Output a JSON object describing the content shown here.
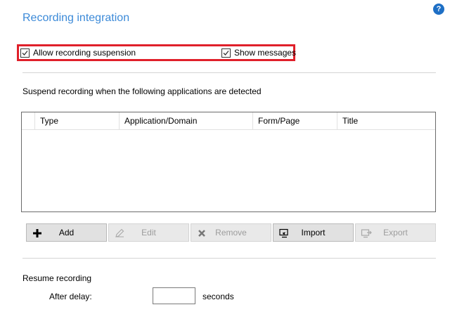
{
  "title": "Recording integration",
  "help_icon": "?",
  "options": {
    "allow_suspension": {
      "label": "Allow recording suspension",
      "checked": true
    },
    "show_messages": {
      "label": "Show messages",
      "checked": true
    }
  },
  "description": "Suspend recording when the following applications are detected",
  "table": {
    "columns": [
      "Type",
      "Application/Domain",
      "Form/Page",
      "Title"
    ],
    "rows": []
  },
  "buttons": {
    "add": {
      "label": "Add",
      "icon": "plus-icon",
      "enabled": true
    },
    "edit": {
      "label": "Edit",
      "icon": "pencil-icon",
      "enabled": false
    },
    "remove": {
      "label": "Remove",
      "icon": "x-icon",
      "enabled": false
    },
    "import": {
      "label": "Import",
      "icon": "import-icon",
      "enabled": true
    },
    "export": {
      "label": "Export",
      "icon": "export-icon",
      "enabled": false
    }
  },
  "resume": {
    "heading": "Resume recording",
    "after_delay_label": "After delay:",
    "delay_value": "",
    "unit": "seconds"
  },
  "colors": {
    "title": "#3c8ad8",
    "highlight": "#e0202a",
    "help": "#1e6fc5"
  }
}
